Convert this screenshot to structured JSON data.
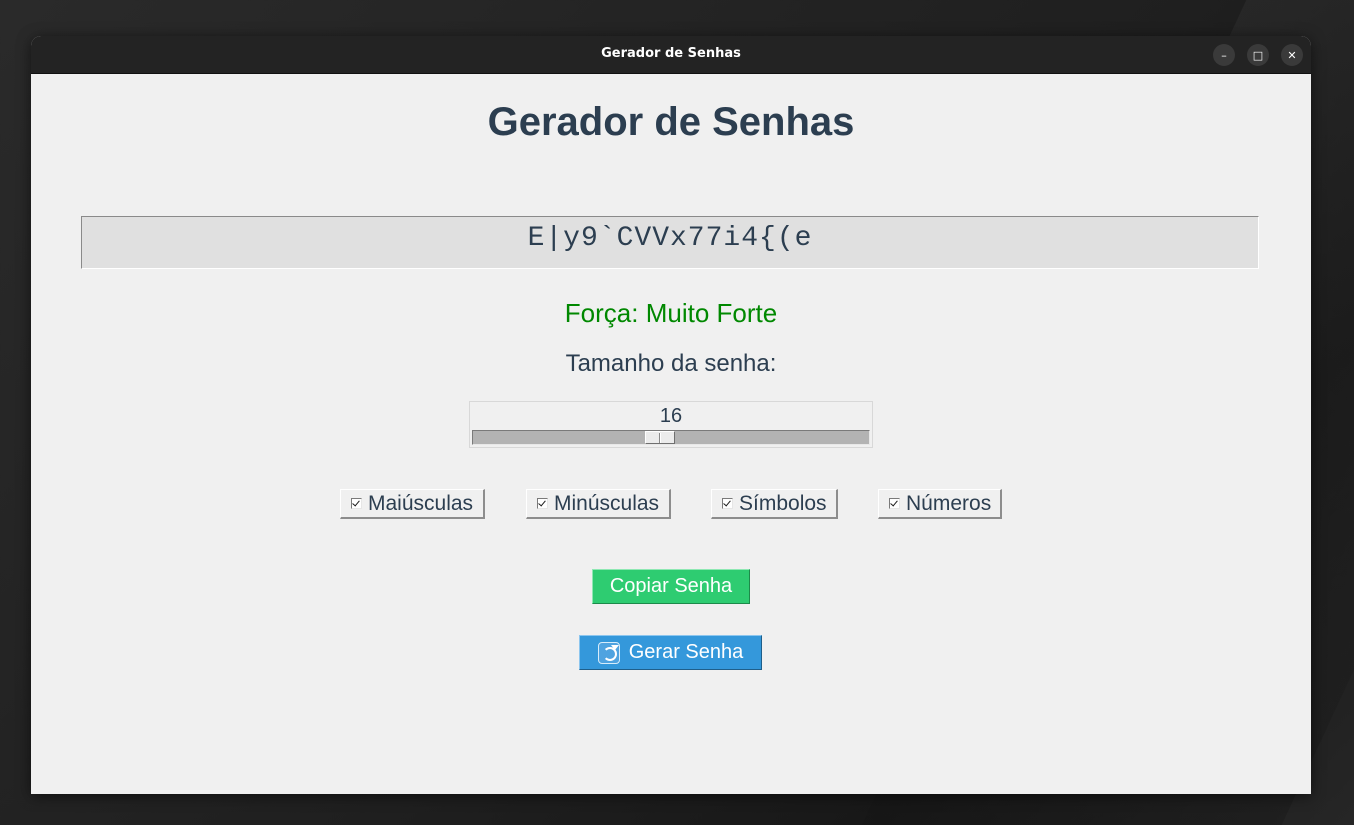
{
  "window": {
    "title": "Gerador de Senhas",
    "controls": {
      "minimize_icon": "minimize-icon",
      "maximize_icon": "maximize-icon",
      "close_icon": "close-icon"
    }
  },
  "app": {
    "heading": "Gerador de Senhas",
    "password": "E|y9`CVVx77i4{(e",
    "strength": "Força: Muito Forte",
    "strength_color": "#008800",
    "length_label": "Tamanho da senha:",
    "length": {
      "value": "16",
      "fraction": 0.47
    },
    "options": [
      {
        "label": "Maiúsculas",
        "checked": true
      },
      {
        "label": "Minúsculas",
        "checked": true
      },
      {
        "label": "Símbolos",
        "checked": true
      },
      {
        "label": "Números",
        "checked": true
      }
    ],
    "copy_button": "Copiar Senha",
    "generate_button": "Gerar Senha",
    "generate_icon": "refresh-icon"
  },
  "colors": {
    "heading": "#2c3e50",
    "copy_button_bg": "#2ecc71",
    "generate_button_bg": "#3498db",
    "window_bg": "#f0f0f0",
    "titlebar_bg": "#232323"
  }
}
